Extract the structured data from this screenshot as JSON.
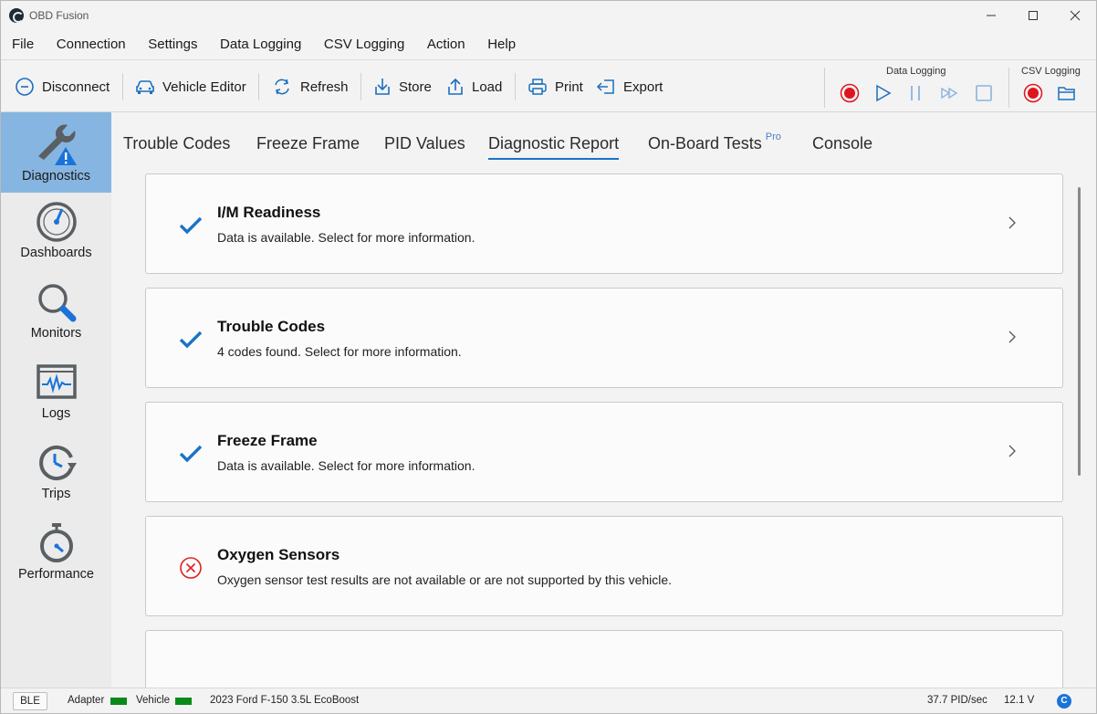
{
  "window": {
    "title": "OBD Fusion"
  },
  "menu": [
    "File",
    "Connection",
    "Settings",
    "Data Logging",
    "CSV Logging",
    "Action",
    "Help"
  ],
  "toolbar": {
    "disconnect": "Disconnect",
    "vehicle_editor": "Vehicle Editor",
    "refresh": "Refresh",
    "store": "Store",
    "load": "Load",
    "print": "Print",
    "export": "Export",
    "data_logging_label": "Data Logging",
    "csv_logging_label": "CSV Logging"
  },
  "sidebar": {
    "items": [
      {
        "label": "Diagnostics",
        "icon": "wrench-warning-icon",
        "active": true
      },
      {
        "label": "Dashboards",
        "icon": "gauge-icon",
        "active": false
      },
      {
        "label": "Monitors",
        "icon": "magnifier-icon",
        "active": false
      },
      {
        "label": "Logs",
        "icon": "waveform-icon",
        "active": false
      },
      {
        "label": "Trips",
        "icon": "clock-arrow-icon",
        "active": false
      },
      {
        "label": "Performance",
        "icon": "stopwatch-icon",
        "active": false
      }
    ]
  },
  "tabs": [
    {
      "label": "Trouble Codes"
    },
    {
      "label": "Freeze Frame"
    },
    {
      "label": "PID Values"
    },
    {
      "label": "Diagnostic Report",
      "active": true
    },
    {
      "label": "On-Board Tests",
      "badge": "Pro"
    },
    {
      "label": "Console"
    }
  ],
  "report_cards": [
    {
      "title": "I/M Readiness",
      "description": "Data is available. Select for more information.",
      "status": "check-icon"
    },
    {
      "title": "Trouble Codes",
      "description": "4 codes found. Select for more information.",
      "status": "check-icon"
    },
    {
      "title": "Freeze Frame",
      "description": "Data is available. Select for more information.",
      "status": "check-icon"
    },
    {
      "title": "Oxygen Sensors",
      "description": "Oxygen sensor test results are not available or are not supported by this vehicle.",
      "status": "error-icon"
    }
  ],
  "status": {
    "connection": "BLE",
    "adapter_label": "Adapter",
    "vehicle_label": "Vehicle",
    "vehicle": "2023 Ford F-150 3.5L EcoBoost",
    "pid_rate": "37.7 PID/sec",
    "voltage": "12.1 V",
    "badge": "C"
  },
  "colors": {
    "accent": "#1a73c8",
    "sidebar_active": "#86b5e1",
    "record_red": "#e0141e",
    "indicator_green": "#0a8a1a",
    "error_red": "#e02020"
  }
}
